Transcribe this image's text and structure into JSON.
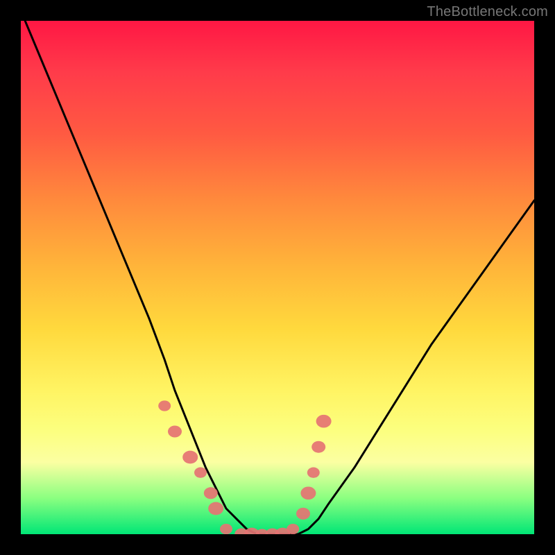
{
  "watermark": "TheBottleneck.com",
  "chart_data": {
    "type": "line",
    "title": "",
    "xlabel": "",
    "ylabel": "",
    "xlim": [
      0,
      100
    ],
    "ylim": [
      0,
      100
    ],
    "grid": false,
    "series": [
      {
        "name": "bottleneck-curve",
        "x": [
          0,
          5,
          10,
          15,
          20,
          25,
          28,
          30,
          32,
          34,
          36,
          38,
          40,
          42,
          44,
          46,
          48,
          50,
          52,
          54,
          56,
          58,
          60,
          65,
          70,
          75,
          80,
          85,
          90,
          95,
          100
        ],
        "values": [
          102,
          90,
          78,
          66,
          54,
          42,
          34,
          28,
          23,
          18,
          13,
          9,
          5,
          3,
          1,
          0,
          0,
          0,
          0,
          0,
          1,
          3,
          6,
          13,
          21,
          29,
          37,
          44,
          51,
          58,
          65
        ]
      },
      {
        "name": "highlight-markers",
        "type": "scatter",
        "x": [
          28,
          30,
          33,
          35,
          37,
          38,
          40,
          43,
          45,
          47,
          49,
          51,
          53,
          55,
          56,
          57,
          58,
          59
        ],
        "values": [
          25,
          20,
          15,
          12,
          8,
          5,
          1,
          0,
          0,
          0,
          0,
          0,
          1,
          4,
          8,
          12,
          17,
          22
        ]
      }
    ],
    "annotations": [],
    "legend": false
  },
  "colors": {
    "curve_stroke": "#000000",
    "marker_fill": "#e57373",
    "background_top": "#ff1744",
    "background_bottom": "#00e676",
    "frame": "#000000"
  }
}
